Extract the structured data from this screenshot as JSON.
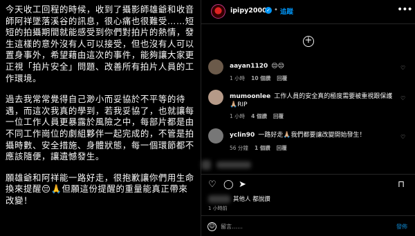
{
  "post_text": {
    "p1": "今天收工回程的時候，收到了攝影師雄爺和收音師阿祥墜落溪谷的訊息，很心痛也很難受……短短的拍攝期間就能感受到你們對拍片的熱情，發生這樣的意外沒有人可以接受，但也沒有人可以置身事外，希望藉由這次的事件，能夠讓大家更正視「拍片安全」問題、改善所有拍片人員的工作環境。",
    "p2": "過去我常常覺得自己渺小而妥協於不平等的待遇，而這次我真的學到，若我妥協了，也就讓每一位工作人員更暴露於風險之中，每部片都是由不同工作崗位的劇組夥伴一起完成的，不管是拍攝時數、安全措施、身體狀態，每一個環節都不應該隨便，讓遺憾發生。",
    "p3": "願雄爺和阿祥能一路好走，很抱歉讓你們用生命換來提醒😔🙏但願這份提醒的重量能真正帶來改變！"
  },
  "header": {
    "username": "ipipy20000",
    "verified": "✓",
    "dot": "•",
    "follow_label": "追蹤",
    "more": "•••"
  },
  "load_more": "+",
  "comments": [
    {
      "user": "aayan1120",
      "text": "😔😔",
      "time": "1 小時",
      "likes": "10 個讚",
      "reply": "回覆",
      "avatar_color": "#6b5a4a"
    },
    {
      "user": "mumoonlee",
      "text": "工作人員的安全真的極度需要被重視跟保護🙏🏼RIP",
      "time": "1 小時",
      "likes": "4 個讚",
      "reply": "回覆",
      "avatar_color": "#b59a88"
    },
    {
      "user": "yclin90",
      "text": "一路好走🙏🏼我們都要讓改變開始發生！",
      "time": "56 分鐘",
      "likes": "1 個讚",
      "reply": "回覆",
      "avatar_color": "#777777"
    }
  ],
  "actions": {
    "like": "♡",
    "comment": "◯",
    "share": "➤",
    "save": "⊓"
  },
  "likes_line": "其他人 都說讚",
  "post_time": "1 小時前",
  "add_comment": {
    "emoji": "☺",
    "placeholder": "留言……",
    "post_label": "發佈"
  }
}
